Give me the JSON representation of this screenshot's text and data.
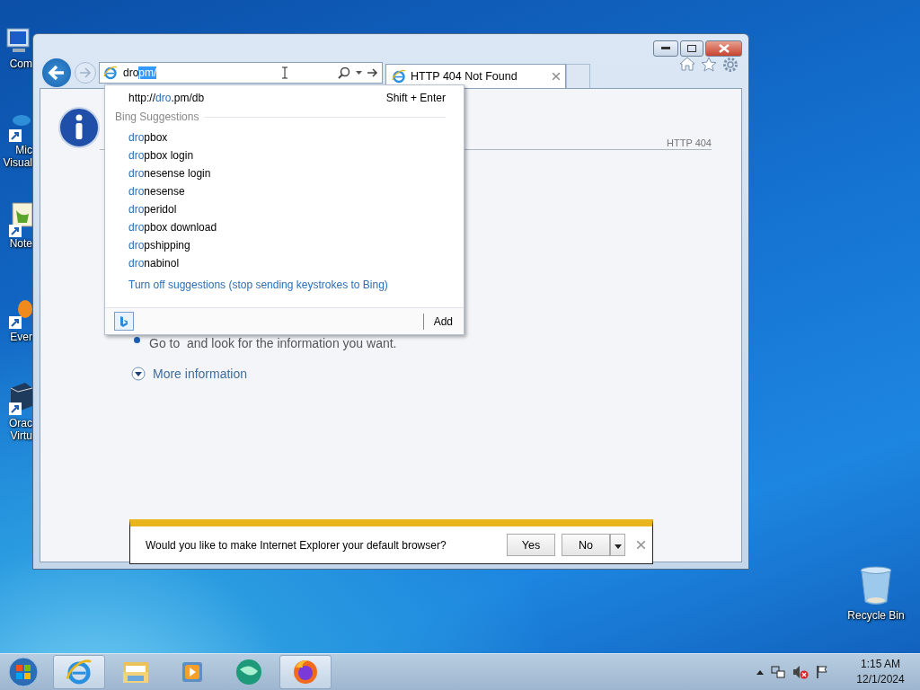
{
  "desktop_icons": [
    {
      "kind": "computer",
      "lines": [
        "Com"
      ]
    },
    {
      "kind": "studio",
      "lines": [
        "Mic",
        "Visual"
      ]
    },
    {
      "kind": "notepad",
      "lines": [
        "Note"
      ]
    },
    {
      "kind": "everything",
      "lines": [
        "Ever"
      ]
    },
    {
      "kind": "virtualbox",
      "lines": [
        "Orac",
        "Virtu"
      ]
    }
  ],
  "recycle_bin": {
    "label": "Recycle Bin"
  },
  "browser": {
    "address_bar": {
      "typed": "dro",
      "autocomplete": "pm/"
    },
    "tabs": [
      {
        "title": "HTTP 404 Not Found",
        "selected": true
      }
    ],
    "dropdown": {
      "url": {
        "prefix": "http://",
        "match": "dro",
        "rest": ".pm/db"
      },
      "shortcut": "Shift + Enter",
      "section": "Bing Suggestions",
      "suggestions": [
        {
          "match": "dro",
          "rest": "pbox"
        },
        {
          "match": "dro",
          "rest": "pbox login"
        },
        {
          "match": "dro",
          "rest": "nesense login"
        },
        {
          "match": "dro",
          "rest": "nesense"
        },
        {
          "match": "dro",
          "rest": "peridol"
        },
        {
          "match": "dro",
          "rest": "pbox download"
        },
        {
          "match": "dro",
          "rest": "pshipping"
        },
        {
          "match": "dro",
          "rest": "nabinol"
        }
      ],
      "turn_off": "Turn off suggestions (stop sending keystrokes to Bing)",
      "add": "Add"
    },
    "page": {
      "code": "HTTP 404",
      "bullet": "Go to  and look for the information you want.",
      "more": "More information",
      "expanded": false
    },
    "notification": {
      "message": "Would you like to make Internet Explorer your default browser?",
      "yes": "Yes",
      "no": "No"
    }
  },
  "taskbar": {
    "apps": [
      {
        "kind": "ie",
        "selected": true
      },
      {
        "kind": "explorer",
        "selected": false
      },
      {
        "kind": "media",
        "selected": false
      },
      {
        "kind": "orb",
        "selected": false
      },
      {
        "kind": "firefox",
        "selected": true
      }
    ],
    "time": "1:15 AM",
    "date": "12/1/2024"
  }
}
